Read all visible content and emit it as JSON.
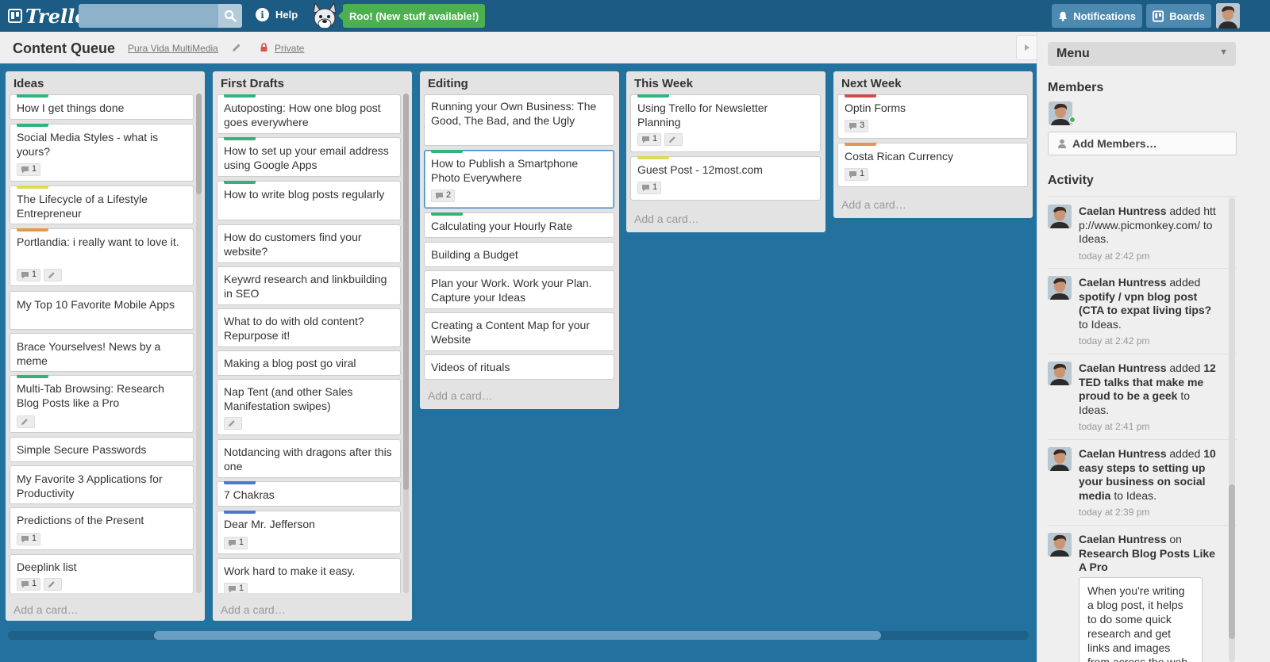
{
  "header": {
    "logo_text": "Trello",
    "search_placeholder": "",
    "help_label": "Help",
    "roo_label": "Roo! (New stuff available!)",
    "notifications_label": "Notifications",
    "boards_label": "Boards"
  },
  "board": {
    "title": "Content Queue",
    "organization": "Pura Vida MultiMedia",
    "visibility": "Private"
  },
  "colors": {
    "green": "#34b27d",
    "yellow": "#dbdb57",
    "orange": "#e09952",
    "red": "#cb4d4d",
    "blue": "#4d77cb"
  },
  "lists": [
    {
      "title": "Ideas",
      "add_card": "Add a card…",
      "cards": [
        {
          "text": "How I get things done",
          "label": "green"
        },
        {
          "text": "Social Media Styles - what is yours?",
          "label": "green",
          "comments": "1"
        },
        {
          "text": "The Lifecycle of a Lifestyle Entrepreneur",
          "label": "yellow"
        },
        {
          "text": "Portlandia: i really want to love it.",
          "label": "orange",
          "comments": "1",
          "edit": true
        },
        {
          "text": "My Top 10 Favorite Mobile Apps"
        },
        {
          "text": "Brace Yourselves! News by a meme"
        },
        {
          "text": "Multi-Tab Browsing: Research Blog Posts like a Pro",
          "label": "green",
          "edit": true
        },
        {
          "text": "Simple Secure Passwords"
        },
        {
          "text": "My Favorite 3 Applications for Productivity"
        },
        {
          "text": "Predictions of the Present",
          "comments": "1"
        },
        {
          "text": "Deeplink list",
          "comments": "1",
          "edit": true
        }
      ]
    },
    {
      "title": "First Drafts",
      "add_card": "Add a card…",
      "cards": [
        {
          "text": "Autoposting: How one blog post goes everywhere",
          "label": "green"
        },
        {
          "text": "How to set up your email address using Google Apps",
          "label": "green"
        },
        {
          "text": "How to write blog posts regularly",
          "label": "green"
        },
        {
          "text": "How do customers find your website?"
        },
        {
          "text": "Keywrd research and linkbuilding in SEO"
        },
        {
          "text": "What to do with old content? Repurpose it!"
        },
        {
          "text": "Making a blog post go viral"
        },
        {
          "text": "Nap Tent (and other Sales Manifestation swipes)",
          "edit": true
        },
        {
          "text": "Notdancing with dragons after this one"
        },
        {
          "text": "7 Chakras",
          "label": "blue"
        },
        {
          "text": "Dear Mr. Jefferson",
          "label": "blue",
          "comments": "1"
        },
        {
          "text": "Work hard to make it easy.",
          "comments": "1"
        }
      ]
    },
    {
      "title": "Editing",
      "add_card": "Add a card…",
      "cards": [
        {
          "text": "Running your Own Business: The Good, The Bad, and the Ugly"
        },
        {
          "text": "How to Publish a Smartphone Photo Everywhere",
          "label": "green",
          "comments": "2"
        },
        {
          "text": "Calculating your Hourly Rate",
          "label": "green"
        },
        {
          "text": "Building a Budget"
        },
        {
          "text": "Plan your Work. Work your Plan. Capture your Ideas"
        },
        {
          "text": "Creating a Content Map for your Website"
        },
        {
          "text": "Videos of rituals"
        }
      ]
    },
    {
      "title": "This Week",
      "add_card": "Add a card…",
      "cards": [
        {
          "text": "Using Trello for Newsletter Planning",
          "label": "green",
          "comments": "1",
          "edit": true
        },
        {
          "text": "Guest Post - 12most.com",
          "label": "yellow",
          "comments": "1"
        }
      ]
    },
    {
      "title": "Next Week",
      "add_card": "Add a card…",
      "cards": [
        {
          "text": "Optin Forms",
          "label": "red",
          "comments": "3"
        },
        {
          "text": "Costa Rican Currency",
          "label": "orange",
          "comments": "1"
        }
      ]
    }
  ],
  "sidebar": {
    "menu_label": "Menu",
    "members_title": "Members",
    "add_members_label": "Add Members…",
    "activity_title": "Activity",
    "activity": [
      {
        "user": "Caelan Huntress",
        "verb": " added ",
        "object": "http://www.picmonkey.com/",
        "suffix": " to Ideas.",
        "time": "today at 2:42 pm"
      },
      {
        "user": "Caelan Huntress",
        "verb": " added ",
        "object": "spotify / vpn blog post (CTA to expat living tips?",
        "suffix": " to Ideas.",
        "time": "today at 2:42 pm"
      },
      {
        "user": "Caelan Huntress",
        "verb": " added ",
        "object": "12 TED talks that make me proud to be a geek",
        "suffix": " to Ideas.",
        "time": "today at 2:41 pm"
      },
      {
        "user": "Caelan Huntress",
        "verb": " added ",
        "object": "10 easy steps to setting up your business on social media",
        "suffix": " to Ideas.",
        "time": "today at 2:39 pm"
      },
      {
        "user": "Caelan Huntress",
        "verb": " on ",
        "object": "Research Blog Posts Like A Pro",
        "suffix": "",
        "time": ""
      }
    ],
    "comment_text": "When you're writing a blog post, it helps to do some quick research and get links and images from across the web"
  }
}
